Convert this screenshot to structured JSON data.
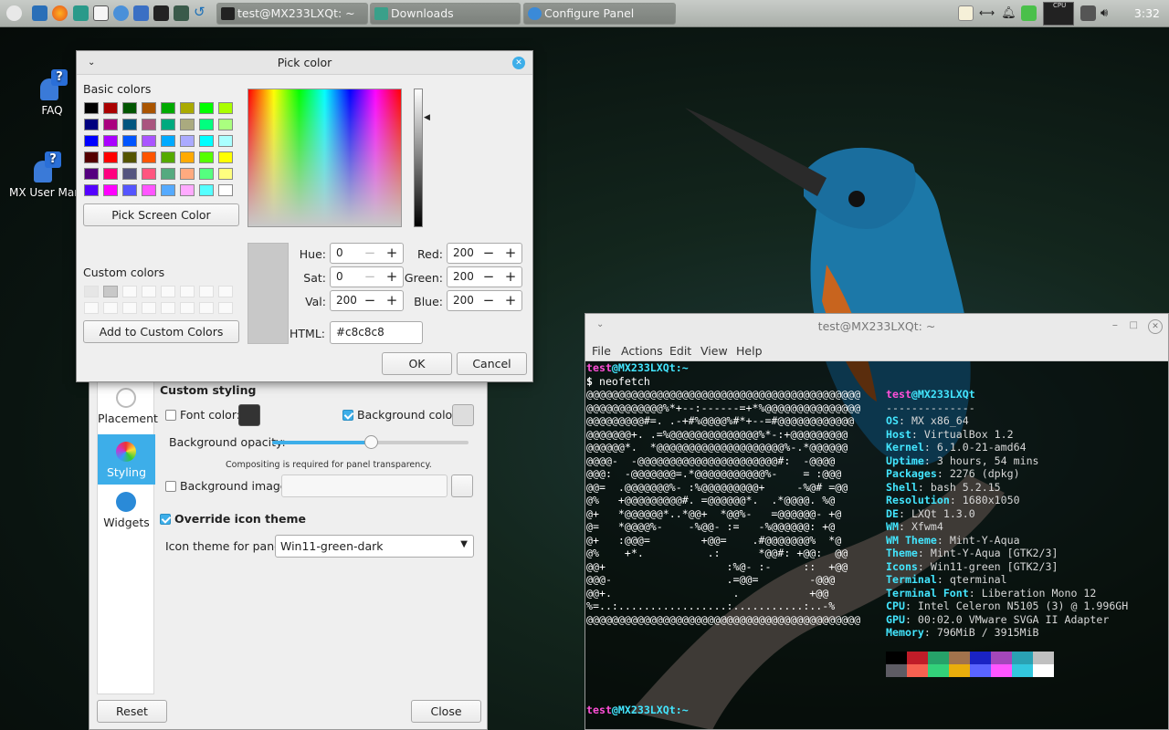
{
  "taskbar": {
    "tasks": [
      {
        "label": "test@MX233LXQt: ~"
      },
      {
        "label": "Downloads"
      },
      {
        "label": "Configure Panel"
      }
    ],
    "cpu_label": "CPU",
    "clock": "3:32"
  },
  "desktop": {
    "icons": [
      {
        "label": "FAQ"
      },
      {
        "label": "MX User Manual"
      }
    ]
  },
  "color_dialog": {
    "title": "Pick color",
    "basic_label": "Basic colors",
    "basic_colors": [
      "#000000",
      "#aa0000",
      "#005500",
      "#aa5500",
      "#00aa00",
      "#aaaa00",
      "#00ff00",
      "#aaff00",
      "#00007f",
      "#aa007f",
      "#00557f",
      "#aa557f",
      "#00aa7f",
      "#aaaa7f",
      "#00ff7f",
      "#aaff7f",
      "#0000ff",
      "#aa00ff",
      "#0055ff",
      "#aa55ff",
      "#00aaff",
      "#aaaaff",
      "#00ffff",
      "#aaffff",
      "#550000",
      "#ff0000",
      "#555500",
      "#ff5500",
      "#55aa00",
      "#ffaa00",
      "#55ff00",
      "#ffff00",
      "#55007f",
      "#ff007f",
      "#55557f",
      "#ff557f",
      "#55aa7f",
      "#ffaa7f",
      "#55ff7f",
      "#ffff7f",
      "#5500ff",
      "#ff00ff",
      "#5555ff",
      "#ff55ff",
      "#55aaff",
      "#ffaaff",
      "#55ffff",
      "#ffffff"
    ],
    "pick_screen_label": "Pick Screen Color",
    "custom_label": "Custom colors",
    "add_custom_label": "Add to Custom Colors",
    "preview_color": "#c8c8c8",
    "fields": {
      "hue": {
        "label": "Hue:",
        "value": "0"
      },
      "sat": {
        "label": "Sat:",
        "value": "0"
      },
      "val": {
        "label": "Val:",
        "value": "200"
      },
      "red": {
        "label": "Red:",
        "value": "200"
      },
      "green": {
        "label": "Green:",
        "value": "200"
      },
      "blue": {
        "label": "Blue:",
        "value": "200"
      },
      "html": {
        "label": "HTML:",
        "value": "#c8c8c8"
      }
    },
    "ok_label": "OK",
    "cancel_label": "Cancel"
  },
  "panel_config": {
    "sidebar": [
      {
        "label": "Placement"
      },
      {
        "label": "Styling"
      },
      {
        "label": "Widgets"
      }
    ],
    "custom_styling": "Custom styling",
    "font_color": "Font color:",
    "background_color": "Background color:",
    "background_opacity": "Background opacity:",
    "opacity_value": 0.5,
    "compositing_note": "Compositing is required for panel transparency.",
    "background_image": "Background image:",
    "override_icon_theme": "Override icon theme",
    "icon_theme_label": "Icon theme for panels:",
    "icon_theme_value": "Win11-green-dark",
    "reset_label": "Reset",
    "close_label": "Close"
  },
  "terminal": {
    "title": "test@MX233LXQt: ~",
    "menu": [
      "File",
      "Actions",
      "Edit",
      "View",
      "Help"
    ],
    "prompt_user": "test",
    "prompt_at": "@",
    "prompt_host": "MX233LXQt",
    "prompt_path": ":~",
    "prompt_dollar": "$ ",
    "command": "neofetch",
    "ascii": [
      "@@@@@@@@@@@@@@@@@@@@@@@@@@@@@@@@@@@@@@@@@@@",
      "@@@@@@@@@@@@%*+--:------=+*%@@@@@@@@@@@@@@@",
      "@@@@@@@@@#=. .-+#%@@@@%#*+--=#@@@@@@@@@@@@",
      "@@@@@@@+. .=%@@@@@@@@@@@@@@%*-:+@@@@@@@@@",
      "@@@@@@*.  *@@@@@@@@@@@@@@@@@@@@%-.*@@@@@@",
      "@@@@-  -@@@@@@@@@@@@@@@@@@@@@@#:  -@@@@",
      "@@@:  -@@@@@@@=.*@@@@@@@@@@@%-    = :@@@",
      "@@=  .@@@@@@@%- :%@@@@@@@@@+     -%@# =@@",
      "@%   +@@@@@@@@@#. =@@@@@@*.  .*@@@@. %@",
      "@+   *@@@@@@*..*@@+  *@@%-   =@@@@@@- +@",
      "@=   *@@@@%-    -%@@- :=   -%@@@@@@: +@",
      "@+   :@@@=        +@@=    .#@@@@@@@%  *@",
      "@%    +*.          .:      *@@#: +@@:  @@",
      "@@+                   :%@- :-     ::  +@@",
      "@@@-                  .=@@=        -@@@",
      "@@+.                   .           +@@",
      "%=..:.................:...........:..-%",
      "@@@@@@@@@@@@@@@@@@@@@@@@@@@@@@@@@@@@@@@@@@@"
    ],
    "info_user": "test",
    "info_at": "@",
    "info_host": "MX233LXQt",
    "separator": "--------------",
    "info": [
      {
        "key": "OS",
        "value": "MX x86_64"
      },
      {
        "key": "Host",
        "value": "VirtualBox 1.2"
      },
      {
        "key": "Kernel",
        "value": "6.1.0-21-amd64"
      },
      {
        "key": "Uptime",
        "value": "3 hours, 54 mins"
      },
      {
        "key": "Packages",
        "value": "2276 (dpkg)"
      },
      {
        "key": "Shell",
        "value": "bash 5.2.15"
      },
      {
        "key": "Resolution",
        "value": "1680x1050"
      },
      {
        "key": "DE",
        "value": "LXQt 1.3.0"
      },
      {
        "key": "WM",
        "value": "Xfwm4"
      },
      {
        "key": "WM Theme",
        "value": "Mint-Y-Aqua"
      },
      {
        "key": "Theme",
        "value": "Mint-Y-Aqua [GTK2/3]"
      },
      {
        "key": "Icons",
        "value": "Win11-green [GTK2/3]"
      },
      {
        "key": "Terminal",
        "value": "qterminal"
      },
      {
        "key": "Terminal Font",
        "value": "Liberation Mono 12"
      },
      {
        "key": "CPU",
        "value": "Intel Celeron N5105 (3) @ 1.996GH"
      },
      {
        "key": "GPU",
        "value": "00:02.0 VMware SVGA II Adapter"
      },
      {
        "key": "Memory",
        "value": "796MiB / 3915MiB"
      }
    ],
    "palette_top": [
      "#000000",
      "#c01c28",
      "#26a269",
      "#a2734c",
      "#1a23c4",
      "#a347ba",
      "#2aa1b3",
      "#c0c0c0"
    ],
    "palette_bottom": [
      "#5e5c64",
      "#f66151",
      "#33d17a",
      "#e9ad0c",
      "#5a64ff",
      "#ff55ff",
      "#33c7de",
      "#ffffff"
    ]
  }
}
